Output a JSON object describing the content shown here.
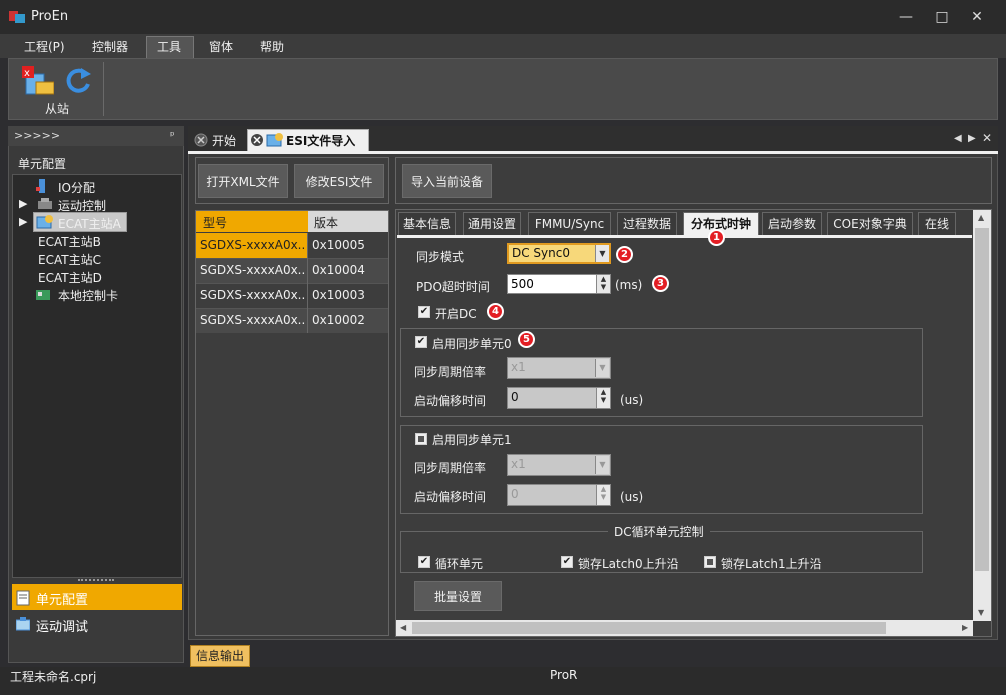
{
  "window": {
    "title": "ProEn",
    "controls": [
      "—",
      "□",
      "✕"
    ]
  },
  "menu": [
    "工程(P)",
    "控制器",
    "工具",
    "窗体",
    "帮助"
  ],
  "ribbon": {
    "slave_label": "从站"
  },
  "left_panel": {
    "header": ">>>>>",
    "title": "单元配置",
    "tree": [
      "IO分配",
      "运动控制",
      "ECAT主站A",
      "ECAT主站B",
      "ECAT主站C",
      "ECAT主站D",
      "本地控制卡"
    ],
    "nav": [
      "单元配置",
      "运动调试"
    ]
  },
  "doc_tabs": [
    "开始",
    "ESI文件导入"
  ],
  "toolbar": {
    "open_xml": "打开XML文件",
    "edit_esi": "修改ESI文件",
    "import_device": "导入当前设备"
  },
  "device_table": {
    "headers": [
      "型号",
      "版本"
    ],
    "rows": [
      [
        "SGDXS-xxxxA0x...",
        "0x10005"
      ],
      [
        "SGDXS-xxxxA0x...",
        "0x10004"
      ],
      [
        "SGDXS-xxxxA0x...",
        "0x10003"
      ],
      [
        "SGDXS-xxxxA0x...",
        "0x10002"
      ]
    ]
  },
  "settings_tabs": [
    "基本信息",
    "通用设置",
    "FMMU/Sync",
    "过程数据",
    "分布式时钟",
    "启动参数",
    "COE对象字典",
    "在线"
  ],
  "dc": {
    "sync_mode_label": "同步模式",
    "sync_mode_value": "DC Sync0",
    "pdo_timeout_label": "PDO超时时间",
    "pdo_timeout_value": "500",
    "pdo_unit": "(ms)",
    "enable_dc_label": "开启DC",
    "sync0": {
      "enable_label": "启用同步单元0",
      "cycle_label": "同步周期倍率",
      "cycle_value": "x1",
      "offset_label": "启动偏移时间",
      "offset_value": "0",
      "unit": "(us)"
    },
    "sync1": {
      "enable_label": "启用同步单元1",
      "cycle_label": "同步周期倍率",
      "cycle_value": "x1",
      "offset_label": "启动偏移时间",
      "offset_value": "0",
      "unit": "(us)"
    },
    "cyclic_group_title": "DC循环单元控制",
    "cyclic_unit": "循环单元",
    "latch0": "锁存Latch0上升沿",
    "latch1": "锁存Latch1上升沿",
    "batch_button": "批量设置"
  },
  "badges": [
    "1",
    "2",
    "3",
    "4",
    "5"
  ],
  "bottom": {
    "output_tab": "信息输出",
    "file": "工程未命名.cprj",
    "center": "ProR"
  },
  "colors": {
    "accent": "#f0a800",
    "badge": "#e31e24",
    "selected_row": "#f0a800"
  }
}
